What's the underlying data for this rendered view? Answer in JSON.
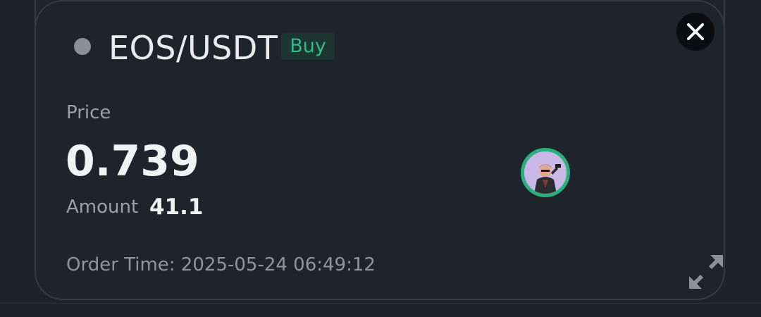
{
  "order": {
    "pair": "EOS/USDT",
    "side": "Buy",
    "price_label": "Price",
    "price": "0.739",
    "amount_label": "Amount",
    "amount": "41.1",
    "order_time": "Order Time: 2025-05-24 06:49:12"
  },
  "icons": {
    "status": "status-dot-icon",
    "close": "close-icon",
    "avatar": "avatar-image",
    "expand": "expand-icon"
  },
  "colors": {
    "background": "#1e222a",
    "buy_green": "#2ebd85",
    "text_primary": "#f1f2f4",
    "text_secondary": "#9aa0ab"
  }
}
